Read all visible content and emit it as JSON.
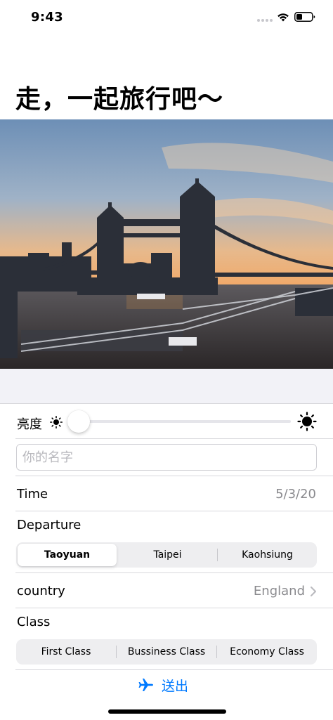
{
  "status_bar": {
    "time": "9:43"
  },
  "page": {
    "title": "走，一起旅行吧～"
  },
  "brightness": {
    "label": "亮度",
    "value_fraction": 0.0
  },
  "name_field": {
    "placeholder": "你的名字",
    "value": ""
  },
  "time_row": {
    "label": "Time",
    "value": "5/3/20"
  },
  "departure": {
    "label": "Departure",
    "options": [
      "Taoyuan",
      "Taipei",
      "Kaohsiung"
    ],
    "selected_index": 0
  },
  "country": {
    "label": "country",
    "value": "England"
  },
  "class_row": {
    "label": "Class",
    "options": [
      "First Class",
      "Bussiness Class",
      "Economy Class"
    ],
    "selected_index": -1
  },
  "send": {
    "label": "送出"
  },
  "colors": {
    "accent": "#007aff",
    "secondary_text": "#8a8a8e",
    "group_background": "#f2f2f7"
  },
  "icons": {
    "wifi": "wifi-icon",
    "battery": "battery-icon",
    "sun_small": "sun-small-icon",
    "sun_large": "sun-large-icon",
    "chevron": "chevron-right-icon",
    "plane": "airplane-icon"
  }
}
